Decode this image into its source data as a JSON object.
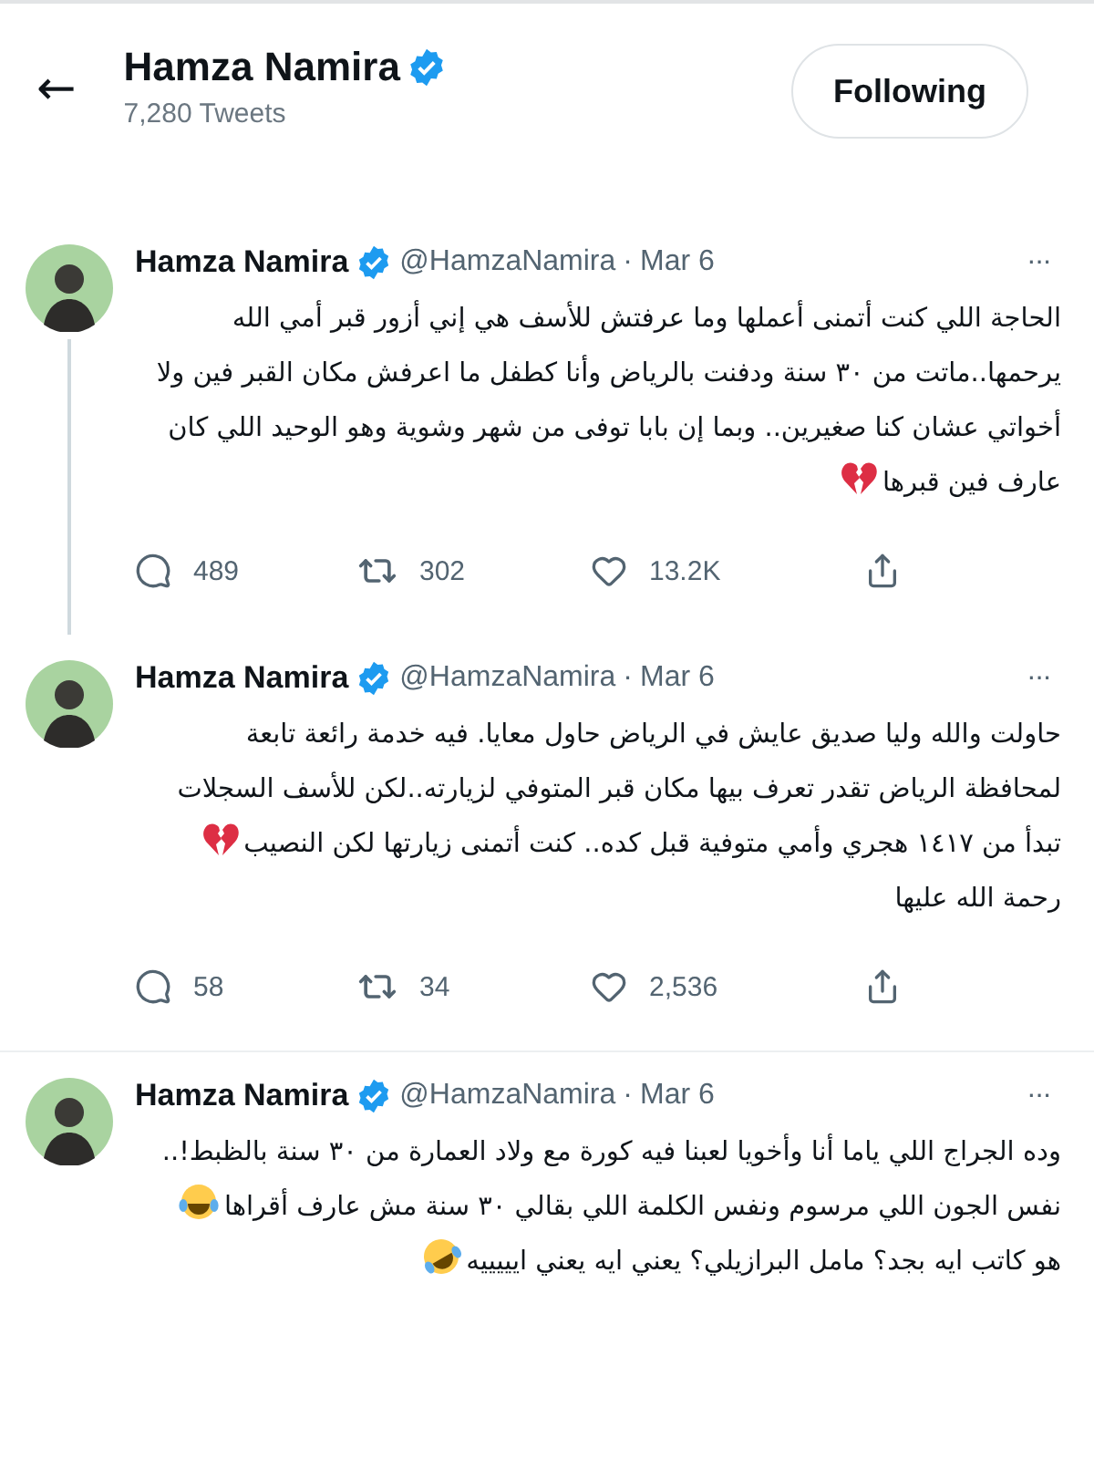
{
  "header": {
    "back": "←",
    "name": "Hamza Namira",
    "verified": true,
    "tweet_count": "7,280 Tweets",
    "follow_button": "Following"
  },
  "tweets": [
    {
      "name": "Hamza Namira",
      "verified": true,
      "handle": "@HamzaNamira",
      "separator": "·",
      "date": "Mar 6",
      "more": "···",
      "thread_line": true,
      "lines": [
        {
          "kind": "plain",
          "text": "الحاجة اللي كنت أتمنى أعملها وما عرفتش للأسف هي إني أزور قبر أمي الله"
        },
        {
          "kind": "plain",
          "text": "يرحمها..ماتت من ٣٠ سنة ودفنت بالرياض وأنا كطفل ما اعرفش مكان القبر فين ولا"
        },
        {
          "kind": "plain",
          "text": "أخواتي عشان كنا صغيرين.. وبما إن بابا توفى من شهر وشوية وهو الوحيد اللي كان"
        },
        {
          "kind": "broken-heart",
          "text": "عارف فين قبرها"
        }
      ],
      "actions": {
        "replies": "489",
        "retweets": "302",
        "likes": "13.2K"
      }
    },
    {
      "name": "Hamza Namira",
      "verified": true,
      "handle": "@HamzaNamira",
      "separator": "·",
      "date": "Mar 6",
      "more": "···",
      "thread_line": false,
      "lines": [
        {
          "kind": "plain",
          "text": "حاولت والله وليا صديق عايش في الرياض حاول معايا. فيه خدمة رائعة تابعة"
        },
        {
          "kind": "plain",
          "text": "لمحافظة الرياض تقدر تعرف بيها مكان قبر المتوفي لزيارته..لكن للأسف السجلات"
        },
        {
          "kind": "broken-heart",
          "text": "تبدأ من ١٤١٧ هجري وأمي متوفية قبل كده.. كنت أتمنى زيارتها لكن النصيب"
        },
        {
          "kind": "plain",
          "text": "رحمة الله عليها"
        }
      ],
      "actions": {
        "replies": "58",
        "retweets": "34",
        "likes": "2,536"
      }
    },
    {
      "name": "Hamza Namira",
      "verified": true,
      "handle": "@HamzaNamira",
      "separator": "·",
      "date": "Mar 6",
      "more": "···",
      "thread_line": false,
      "lines": [
        {
          "kind": "plain",
          "text": "وده الجراج اللي ياما أنا وأخويا لعبنا فيه كورة مع ولاد العمارة من ٣٠ سنة بالظبط!.."
        },
        {
          "kind": "tears-of-joy",
          "text": "نفس الجون اللي مرسوم ونفس الكلمة اللي بقالي ٣٠ سنة مش عارف أقراها"
        },
        {
          "kind": "rolling-laugh",
          "text": "هو كاتب ايه بجد؟ مامل البرازيلي؟ يعني ايه يعني ايييييه"
        }
      ]
    }
  ]
}
